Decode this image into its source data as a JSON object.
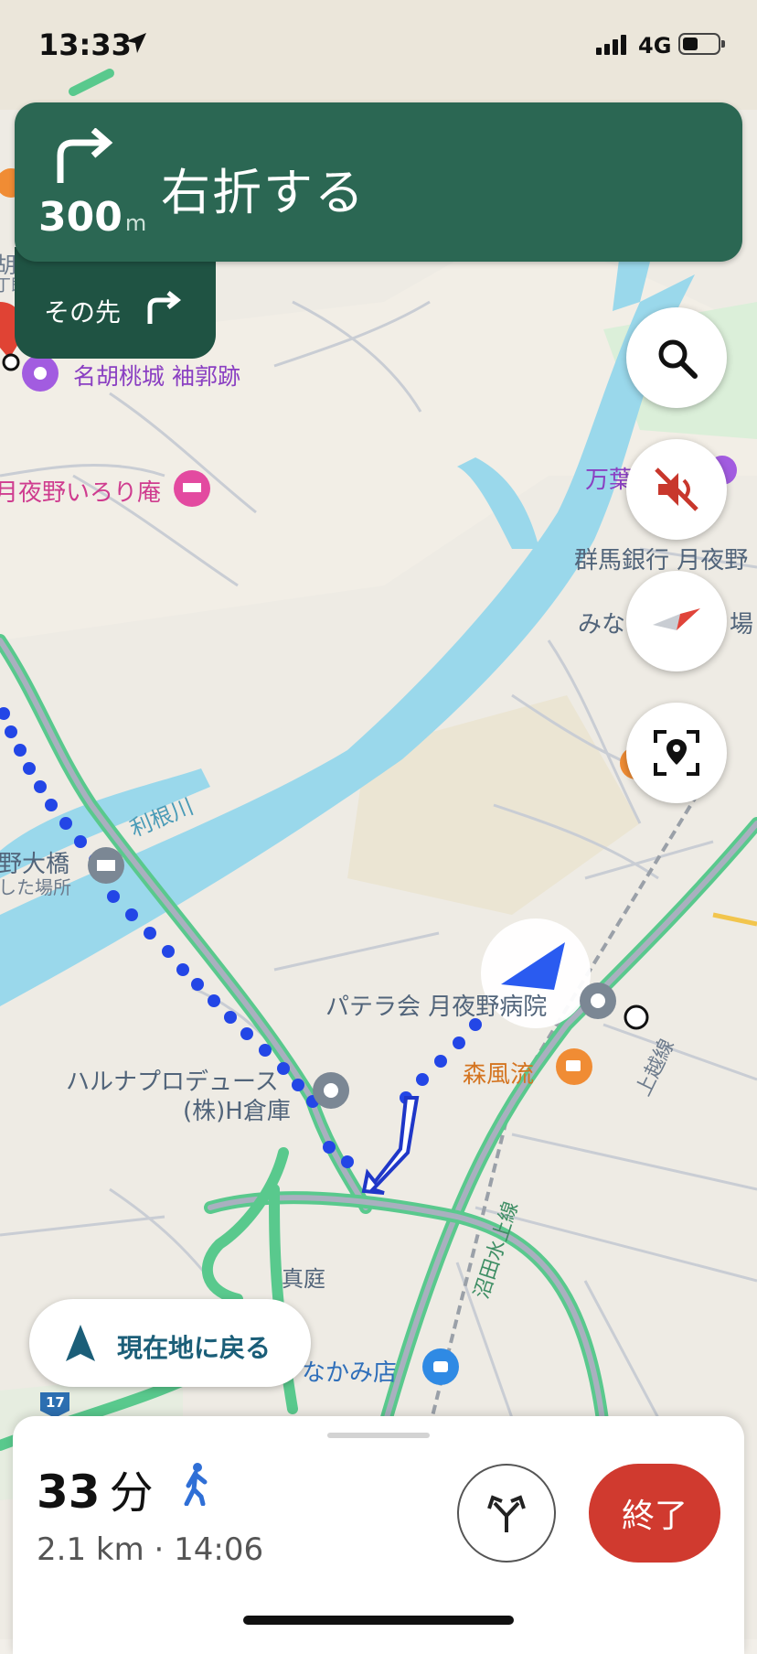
{
  "status": {
    "time": "13:33",
    "network": "4G"
  },
  "nav": {
    "distance": "300",
    "distance_unit": "m",
    "instruction": "右折する",
    "then_label": "その先"
  },
  "map_labels": {
    "castle": "名胡桃城 袖郭跡",
    "irori": "月夜野いろり庵",
    "manyo": "万葉",
    "bank": "群馬銀行 月夜野",
    "mina": "みな",
    "ba": "場",
    "tone_river": "利根川",
    "bridge": "野大橋",
    "bridge_sub": "した場所",
    "hospital": "パテラ会 月夜野病院",
    "cafe": "森風流",
    "warehouse1": "ハルナプロデュース",
    "warehouse2": "(株)H倉庫",
    "joetsu_line": "上越線",
    "numata_road": "沼田水上線",
    "maniwa": "真庭",
    "store": "なかみ店",
    "route_num": "17",
    "left_edge1": "胡",
    "left_edge2": "丁既"
  },
  "recenter_label": "現在地に戻る",
  "eta": {
    "minutes": "33",
    "minutes_unit": "分",
    "details": "2.1 km · 14:06"
  },
  "end_label": "終了",
  "icons": {
    "location_arrow": "location-arrow-icon",
    "turn_right": "turn-right-icon",
    "search": "search-icon",
    "mute": "volume-mute-icon",
    "compass": "compass-icon",
    "report": "report-location-icon",
    "walk": "walk-icon",
    "alt_routes": "alternate-routes-icon"
  },
  "colors": {
    "nav_green": "#2b6753",
    "end_red": "#d03a2f",
    "route_blue": "#2346e6",
    "water": "#9ad8eb",
    "road_green": "#5bc98d"
  }
}
